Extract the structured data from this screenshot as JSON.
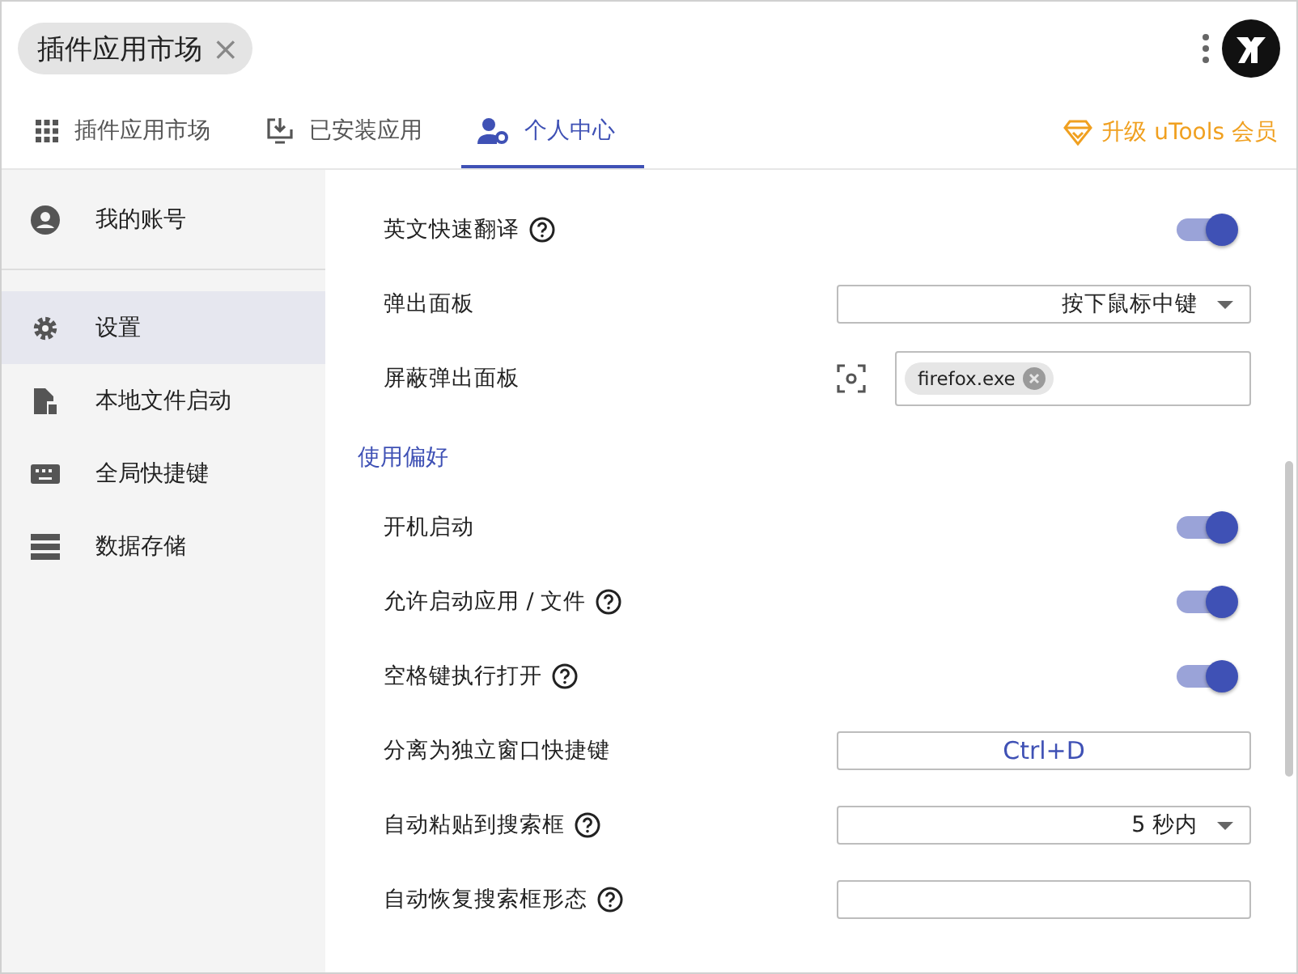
{
  "header": {
    "chip": {
      "label": "插件应用市场",
      "close": "×"
    }
  },
  "tabs": [
    {
      "label": "插件应用市场",
      "selected": false
    },
    {
      "label": "已安装应用",
      "selected": false
    },
    {
      "label": "个人中心",
      "selected": true
    }
  ],
  "upgrade": {
    "label": "升级 uTools 会员"
  },
  "sidebar": {
    "items": [
      {
        "label": "我的账号",
        "selected": false
      },
      {
        "label": "设置",
        "selected": true
      },
      {
        "label": "本地文件启动",
        "selected": false
      },
      {
        "label": "全局快捷键",
        "selected": false
      },
      {
        "label": "数据存储",
        "selected": false
      }
    ]
  },
  "sections": [
    {
      "items": [
        {
          "kind": "toggle",
          "label": "英文快速翻译",
          "help": true,
          "on": true
        },
        {
          "kind": "select",
          "label": "弹出面板",
          "value": "按下鼠标中键"
        },
        {
          "kind": "blocklist",
          "label": "屏蔽弹出面板",
          "tags": [
            "firefox.exe"
          ]
        }
      ]
    },
    {
      "title": "使用偏好",
      "items": [
        {
          "kind": "toggle",
          "label": "开机启动",
          "help": false,
          "on": true
        },
        {
          "kind": "toggle",
          "label": "允许启动应用 / 文件",
          "help": true,
          "on": true
        },
        {
          "kind": "toggle",
          "label": "空格键执行打开",
          "help": true,
          "on": true
        },
        {
          "kind": "hotkey",
          "label": "分离为独立窗口快捷键",
          "value": "Ctrl+D"
        },
        {
          "kind": "select",
          "label": "自动粘贴到搜索框",
          "help": true,
          "value": "5 秒内"
        },
        {
          "kind": "field",
          "label": "自动恢复搜索框形态",
          "help": true
        }
      ]
    }
  ]
}
